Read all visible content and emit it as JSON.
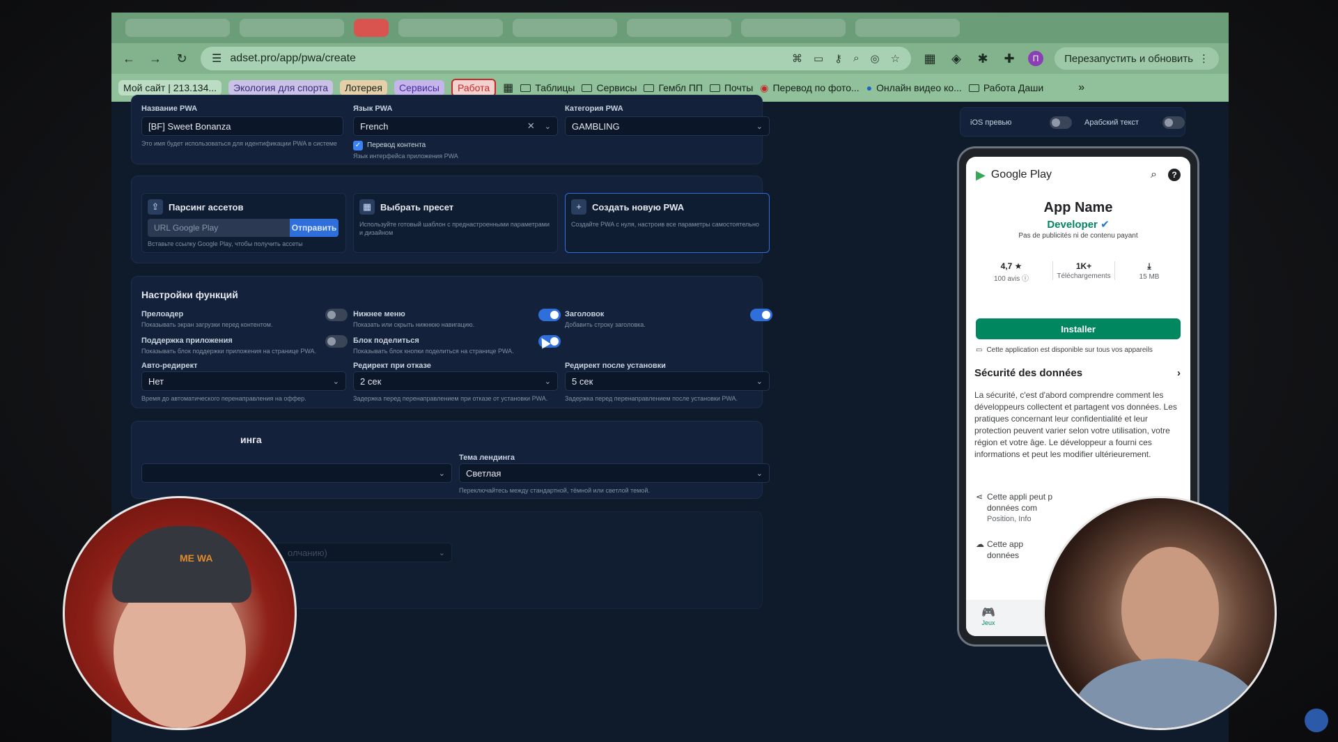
{
  "browser": {
    "url": "adset.pro/app/pwa/create",
    "restart_label": "Перезапустить и обновить",
    "profile_initial": "П",
    "bookmarks": [
      {
        "label": "Мой сайт | 213.134...",
        "style": "green"
      },
      {
        "label": "Экология для спорта",
        "style": "purple"
      },
      {
        "label": "Лотерея",
        "style": "orange"
      },
      {
        "label": "Сервисы",
        "style": "violet"
      },
      {
        "label": "Работа",
        "style": "red"
      }
    ],
    "folders": [
      "Таблицы",
      "Сервисы",
      "Гембл ПП",
      "Почты",
      "Перевод по фото...",
      "Онлайн видео ко...",
      "Работа Даши"
    ],
    "more": "»"
  },
  "basic": {
    "name_label": "Название PWA",
    "name_value": "[BF] Sweet Bonanza",
    "name_hint": "Это имя будет использоваться для идентификации PWA в системе",
    "lang_label": "Язык PWA",
    "lang_value": "French",
    "translate_label": "Перевод контента",
    "translate_hint": "Язык интерфейса приложения PWA",
    "category_label": "Категория PWA",
    "category_value": "GAMBLING"
  },
  "sources": {
    "parse_title": "Парсинг ассетов",
    "parse_placeholder": "URL Google Play",
    "parse_button": "Отправить",
    "parse_hint": "Вставьте ссылку Google Play, чтобы получить ассеты",
    "preset_title": "Выбрать пресет",
    "preset_desc": "Используйте готовый шаблон с преднастроенными параметрами и дизайном",
    "new_title": "Создать новую PWA",
    "new_desc": "Создайте PWA с нуля, настроив все параметры самостоятельно"
  },
  "features": {
    "title": "Настройки функций",
    "preloader_label": "Прелоадер",
    "preloader_hint": "Показывать экран загрузки перед контентом.",
    "bottom_menu_label": "Нижнее меню",
    "bottom_menu_hint": "Показать или скрыть нижнюю навигацию.",
    "header_label": "Заголовок",
    "header_hint": "Добавить строку заголовка.",
    "support_label": "Поддержка приложения",
    "support_hint": "Показывать блок поддержки приложения на странице PWA.",
    "share_label": "Блок поделиться",
    "share_hint": "Показывать блок кнопки поделиться на странице PWA.",
    "autoredirect_label": "Авто-редирект",
    "autoredirect_value": "Нет",
    "autoredirect_hint": "Время до автоматического перенаправления на оффер.",
    "decline_label": "Редирект при отказе",
    "decline_value": "2 сек",
    "decline_hint": "Задержка перед перенаправлением при отказе от установки PWA.",
    "after_label": "Редирект после установки",
    "after_value": "5 сек",
    "after_hint": "Задержка перед перенаправлением после установки PWA."
  },
  "landing": {
    "title_partial": "инга",
    "theme_label": "Тема лендинга",
    "theme_value": "Светлая",
    "theme_hint": "Переключайтесь между стандартной, тёмной или светлой темой.",
    "faded_value": "олчанию)"
  },
  "preview": {
    "ios_label": "iOS превью",
    "arabic_label": "Арабский текст",
    "store_name": "Google Play",
    "app_name": "App Name",
    "developer": "Developer",
    "ads_note": "Pas de publicités ni de contenu payant",
    "rating": "4,7 ★",
    "reviews": "100 avis ⓘ",
    "downloads": "1K+",
    "downloads_label": "Téléchargements",
    "size": "15 MB",
    "install": "Installer",
    "devices_note": "Cette application est disponible sur tous vos appareils",
    "security_title": "Sécurité des données",
    "security_text": "La sécurité, c'est d'abord comprendre comment les développeurs collectent et partagent vos données. Les pratiques concernant leur confidentialité et leur protection peuvent varier selon votre utilisation, votre région et votre âge. Le développeur a fourni ces informations et peut les modifier ultérieurement.",
    "item1": "Cette appli peut p",
    "item1b": "données com",
    "item1c": "Position, Info",
    "item2": "Cette app",
    "item2b": "données",
    "nav_games": "Jeux"
  },
  "overlay": {
    "cap_text": "ME WA"
  }
}
